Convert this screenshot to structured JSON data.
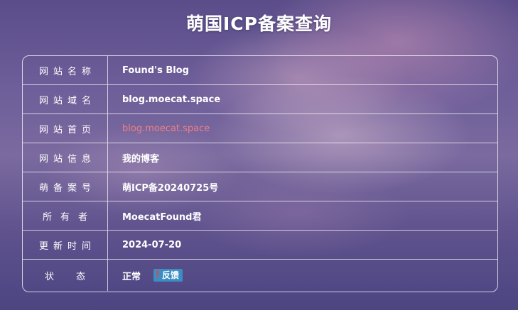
{
  "page": {
    "title": "萌国ICP备案查询"
  },
  "table": {
    "rows": [
      {
        "label": "网站名称",
        "value": "Found's Blog"
      },
      {
        "label": "网站域名",
        "value": "blog.moecat.space"
      },
      {
        "label": "网站首页",
        "value": "blog.moecat.space"
      },
      {
        "label": "网站信息",
        "value": "我的博客"
      },
      {
        "label": "萌备案号",
        "value": "萌ICP备20240725号"
      },
      {
        "label": "所有者",
        "value": "MoecatFound君"
      },
      {
        "label": "更新时间",
        "value": "2024-07-20"
      },
      {
        "label": "状态",
        "value": "正常"
      }
    ]
  },
  "status": {
    "feedback_label": "反馈",
    "warning_glyph": "!"
  },
  "colors": {
    "link": "#f07f84",
    "feedback_bg": "#3b8dc2",
    "warning": "#ff3b30"
  }
}
